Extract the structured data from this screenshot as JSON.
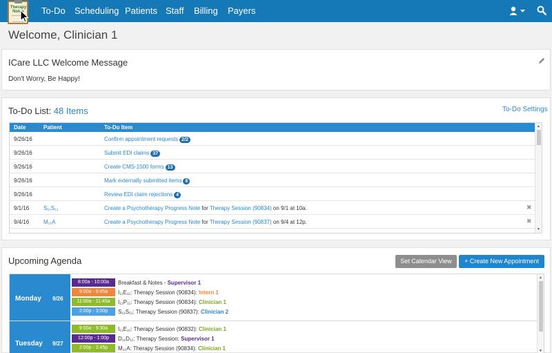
{
  "nav": {
    "logo_text": "Therapy Notes",
    "items": [
      "To-Do",
      "Scheduling",
      "Patients",
      "Staff",
      "Billing",
      "Payers"
    ]
  },
  "page_title": "Welcome, Clinician 1",
  "welcome": {
    "title": "ICare LLC Welcome Message",
    "message": "Don't Worry, Be Happy!"
  },
  "todo": {
    "title": "To-Do List:",
    "count": "48 Items",
    "settings": "To-Do Settings",
    "columns": [
      "Date",
      "Patient",
      "To-Do Item"
    ],
    "rows": [
      {
        "date": "9/26/16",
        "patient": "",
        "item": "Confirm appointment requests",
        "badge": "2/2"
      },
      {
        "date": "9/26/16",
        "patient": "",
        "item": "Submit EDI claims",
        "badge": "37"
      },
      {
        "date": "9/26/16",
        "patient": "",
        "item": "Create CMS-1500 forms",
        "badge": "13"
      },
      {
        "date": "9/26/16",
        "patient": "",
        "item": "Mark externally submitted items",
        "badge": "6"
      },
      {
        "date": "9/26/16",
        "patient": "",
        "item": "Review EDI claim rejections",
        "badge": "4"
      },
      {
        "date": "9/1/16",
        "patient": "S₁₁S₁₁",
        "item": "Create a Psychotherapy Progress Note",
        "for": "for",
        "session": "Therapy Session (90834)",
        "when": "on 9/1 at 10a."
      },
      {
        "date": "9/4/16",
        "patient": "M₁₁A",
        "item": "Create a Psychotherapy Progress Note",
        "for": "for",
        "session": "Therapy Session (90837)",
        "when": "on 9/4 at 12p."
      }
    ]
  },
  "agenda": {
    "title": "Upcoming Agenda",
    "set_view": "Set Calendar View",
    "create": "+ Create New Appointment",
    "days": [
      {
        "name": "Monday",
        "date": "9/26",
        "events": [
          {
            "time": "8:00a - 10:00a",
            "color": "#5a2b8e",
            "desc": "Breakfast & Notes - ",
            "who": "Supervisor 1",
            "who_color": "#5a2b8e"
          },
          {
            "time": "9:00a - 9:45a",
            "color": "#f0873a",
            "desc": "I₁₁E₁₁: Therapy Session (90834): ",
            "who": "Intern 1",
            "who_color": "#f0873a"
          },
          {
            "time": "11:00a - 11:45a",
            "color": "#8dbb2a",
            "desc": "I₁₁P₁₁: Therapy Session (90834): ",
            "who": "Clinician 1",
            "who_color": "#7aa81d"
          },
          {
            "time": "2:00p - 3:00p",
            "color": "#4aa3e0",
            "desc": "S₁₁S₁₁: Therapy Session (90837): ",
            "who": "Clinician 2",
            "who_color": "#2a88c9"
          }
        ]
      },
      {
        "name": "Tuesday",
        "date": "9/27",
        "events": [
          {
            "time": "9:00a - 9:30a",
            "color": "#8dbb2a",
            "desc": "I₁₁E₁₁: Therapy Session (90832): ",
            "who": "Clinician 1",
            "who_color": "#7aa81d"
          },
          {
            "time": "12:00p - 1:00p",
            "color": "#5a2b8e",
            "desc": "D₁₁D₁₁: Therapy Session: ",
            "who": "Supervisor 1",
            "who_color": "#5a2b8e"
          },
          {
            "time": "2:00p - 2:45p",
            "color": "#8dbb2a",
            "desc": "M₁₁A: Therapy Session (90834): ",
            "who": "Clinician 1",
            "who_color": "#7aa81d"
          }
        ]
      }
    ]
  }
}
